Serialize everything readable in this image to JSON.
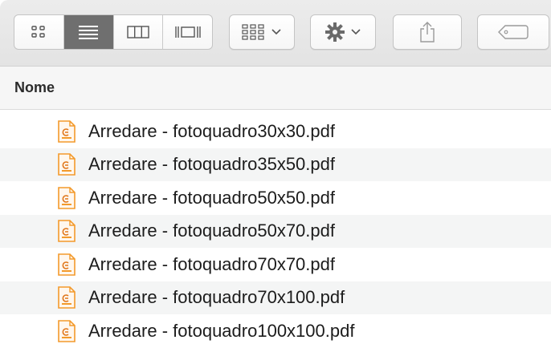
{
  "list_header": {
    "name_column": "Nome"
  },
  "files": [
    {
      "name": "Arredare - fotoquadro30x30.pdf",
      "icon": "pdf-document-icon"
    },
    {
      "name": "Arredare - fotoquadro35x50.pdf",
      "icon": "pdf-document-icon"
    },
    {
      "name": "Arredare - fotoquadro50x50.pdf",
      "icon": "pdf-document-icon"
    },
    {
      "name": "Arredare - fotoquadro50x70.pdf",
      "icon": "pdf-document-icon"
    },
    {
      "name": "Arredare - fotoquadro70x70.pdf",
      "icon": "pdf-document-icon"
    },
    {
      "name": "Arredare - fotoquadro70x100.pdf",
      "icon": "pdf-document-icon"
    },
    {
      "name": "Arredare - fotoquadro100x100.pdf",
      "icon": "pdf-document-icon"
    }
  ],
  "toolbar": {
    "view_modes": [
      "icon-view",
      "list-view",
      "column-view",
      "cover-flow-view"
    ],
    "active_view": "list-view",
    "buttons": [
      "group-by-button",
      "action-gear-button",
      "share-button",
      "tag-button"
    ]
  },
  "colors": {
    "accent_icon": "#f39a2b",
    "active_segment": "#6f6f6f",
    "row_alt": "#f4f5f5"
  }
}
